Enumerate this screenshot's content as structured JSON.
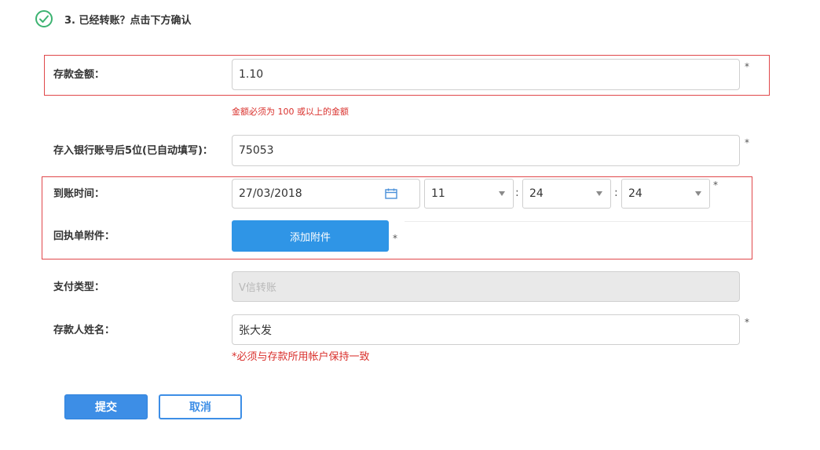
{
  "header": {
    "step_title": "3. 已经转账？点击下方确认"
  },
  "deposit_amount": {
    "label": "存款金额：",
    "value": "1.10",
    "required_mark": "*",
    "error": "金额必须为 100 或以上的金额"
  },
  "bank_account": {
    "label": "存入银行账号后5位(已自动填写)：",
    "value": "75053",
    "required_mark": "*"
  },
  "arrival_time": {
    "label": "到账时间：",
    "date": "27/03/2018",
    "hour": "11",
    "minute": "24",
    "second": "24",
    "separator": ":",
    "required_mark": "*"
  },
  "attachment": {
    "label": "回执单附件：",
    "button": "添加附件",
    "required_mark": "*"
  },
  "payment_type": {
    "label": "支付类型：",
    "value": "V信转账"
  },
  "depositor_name": {
    "label": "存款人姓名：",
    "value": "张大发",
    "required_mark": "*",
    "hint": "*必须与存款所用帐户保持一致"
  },
  "actions": {
    "submit": "提交",
    "cancel": "取消"
  },
  "colors": {
    "accent": "#2f95e6",
    "error": "#d9302c",
    "highlight_border": "#e0474a",
    "check_green": "#3cb371"
  }
}
